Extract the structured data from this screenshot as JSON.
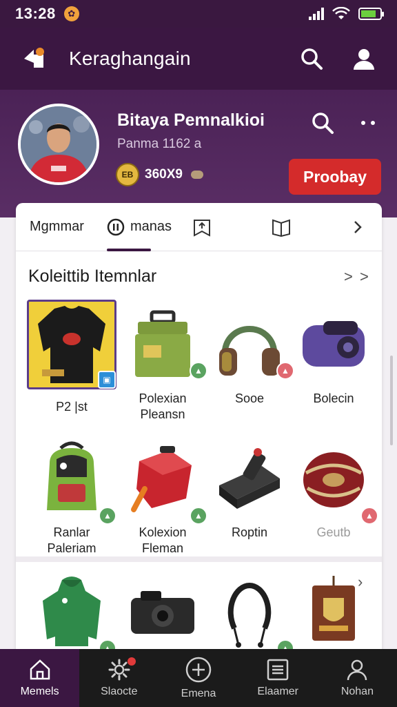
{
  "status_bar": {
    "time": "13:28"
  },
  "app_bar": {
    "title": "Keraghangain"
  },
  "profile": {
    "name": "Bitaya Pemnalkioi",
    "subtitle": "Panma 1162 a",
    "coins": "360X9",
    "follow_button": "Proobay"
  },
  "tabs": [
    {
      "label": "Mgmmar"
    },
    {
      "label": "manas"
    },
    {
      "label": ""
    },
    {
      "label": ""
    },
    {
      "label": ""
    }
  ],
  "section": {
    "title": "Koleittib Itemnlar",
    "more": "> >"
  },
  "items": [
    {
      "line1": "P2 |st",
      "line2": ""
    },
    {
      "line1": "Polexian",
      "line2": "Pleansn"
    },
    {
      "line1": "Sooe",
      "line2": ""
    },
    {
      "line1": "Bolecin",
      "line2": ""
    },
    {
      "line1": "Ranlar",
      "line2": "Paleriam"
    },
    {
      "line1": "Kolexion",
      "line2": "Fleman"
    },
    {
      "line1": "Roptin",
      "line2": ""
    },
    {
      "line1": "Geutb",
      "line2": ""
    }
  ],
  "bottom_nav": [
    {
      "label": "Memels"
    },
    {
      "label": "Slaocte"
    },
    {
      "label": "Emena"
    },
    {
      "label": "Elaamer"
    },
    {
      "label": "Nohan"
    }
  ],
  "colors": {
    "primary": "#3b1742",
    "accent_red": "#d42b2b",
    "nav_bg": "#1b1b1b"
  }
}
